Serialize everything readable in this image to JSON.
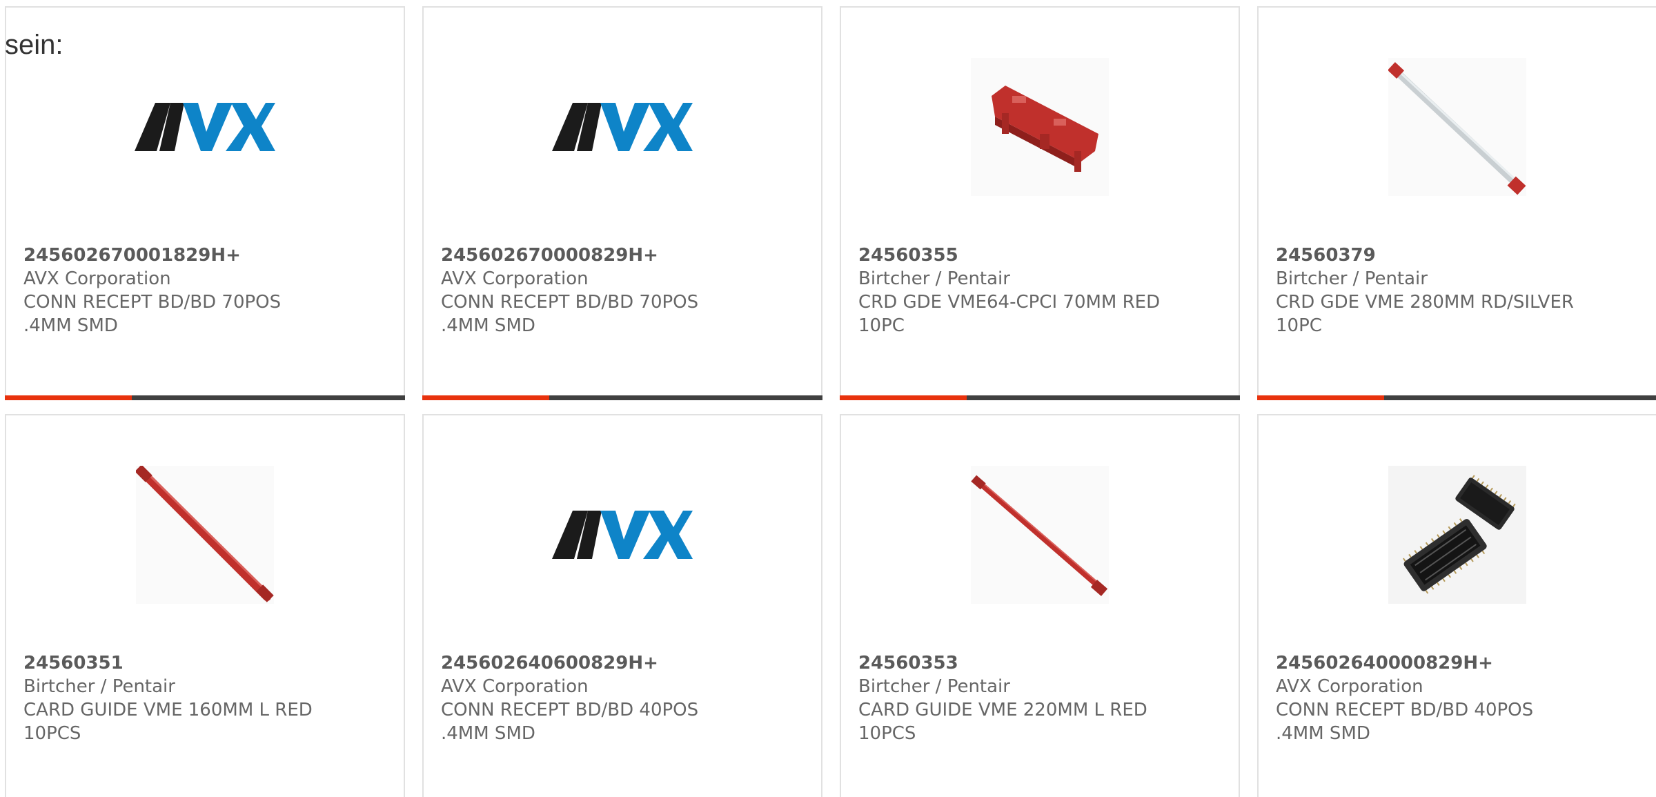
{
  "intro_text": "sein:",
  "colors": {
    "card_border": "#e1e1e1",
    "bar_dark": "#404040",
    "bar_accent": "#e8320d",
    "text": "#666666",
    "avx_black": "#1b1b1b",
    "avx_blue": "#0e84c8",
    "guide_red": "#c0302c"
  },
  "products": [
    {
      "part_number": "245602670001829H+",
      "manufacturer": "AVX Corporation",
      "description_line1": "CONN RECEPT BD/BD 70POS",
      "description_line2": ".4MM SMD",
      "image": "avx-logo"
    },
    {
      "part_number": "245602670000829H+",
      "manufacturer": "AVX Corporation",
      "description_line1": "CONN RECEPT BD/BD 70POS",
      "description_line2": ".4MM SMD",
      "image": "avx-logo"
    },
    {
      "part_number": "24560355",
      "manufacturer": "Birtcher / Pentair",
      "description_line1": "CRD GDE VME64-CPCI 70MM RED",
      "description_line2": "10PC",
      "image": "red-short-card-guide"
    },
    {
      "part_number": "24560379",
      "manufacturer": "Birtcher / Pentair",
      "description_line1": "CRD GDE VME 280MM RD/SILVER",
      "description_line2": "10PC",
      "image": "silver-card-guide"
    },
    {
      "part_number": "24560351",
      "manufacturer": "Birtcher / Pentair",
      "description_line1": "CARD GUIDE VME 160MM L RED",
      "description_line2": "10PCS",
      "image": "red-card-guide"
    },
    {
      "part_number": "245602640600829H+",
      "manufacturer": "AVX Corporation",
      "description_line1": "CONN RECEPT BD/BD 40POS",
      "description_line2": ".4MM SMD",
      "image": "avx-logo"
    },
    {
      "part_number": "24560353",
      "manufacturer": "Birtcher / Pentair",
      "description_line1": "CARD GUIDE VME 220MM L RED",
      "description_line2": "10PCS",
      "image": "red-card-guide"
    },
    {
      "part_number": "245602640000829H+",
      "manufacturer": "AVX Corporation",
      "description_line1": "CONN RECEPT BD/BD 40POS",
      "description_line2": ".4MM SMD",
      "image": "black-connector-pair"
    }
  ]
}
